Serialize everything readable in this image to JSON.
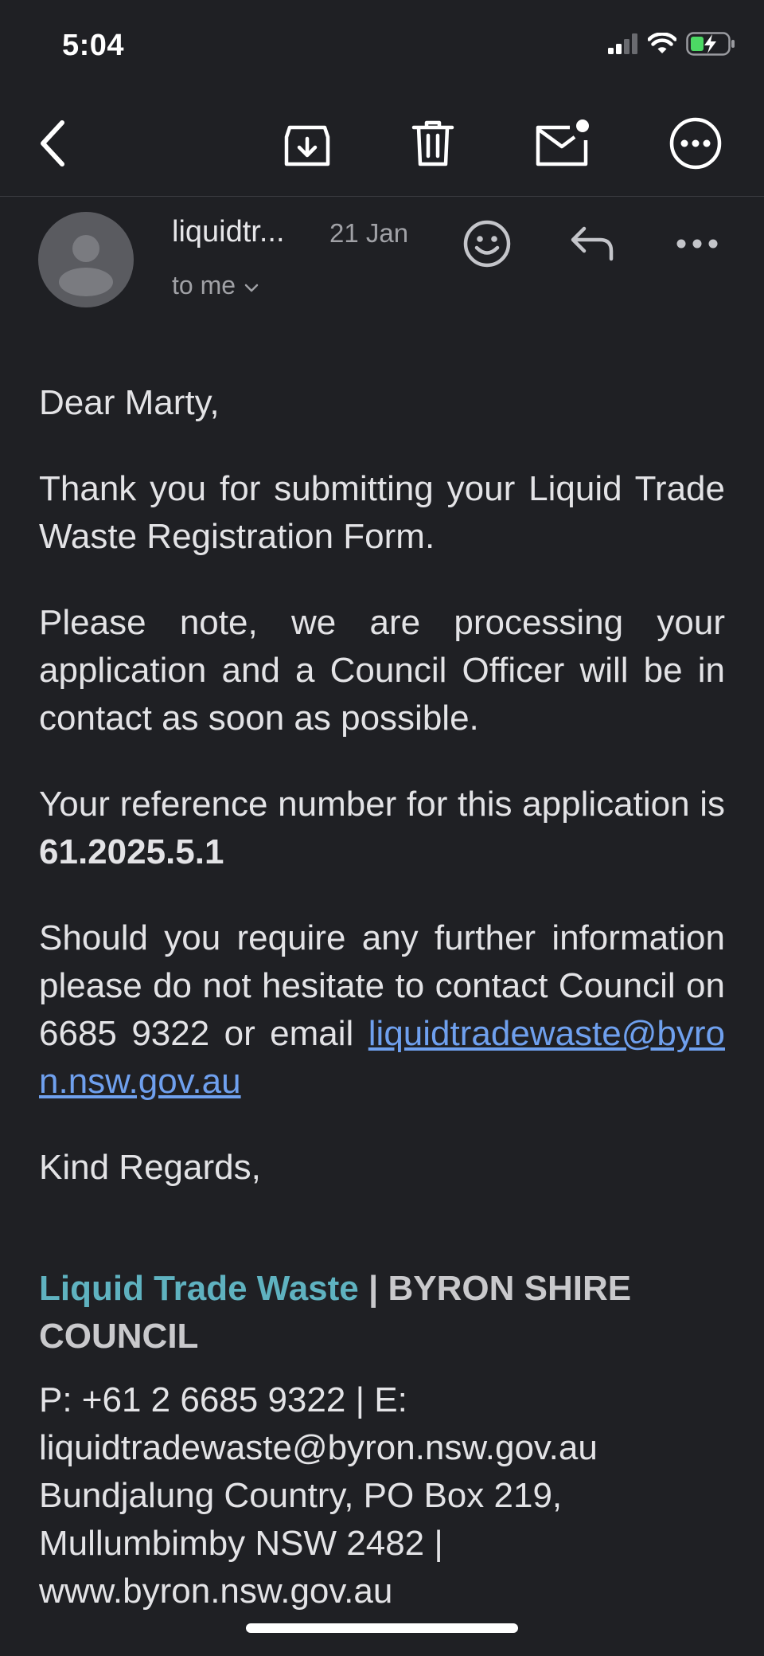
{
  "status_bar": {
    "time": "5:04"
  },
  "toolbar": {
    "icons": [
      "back-arrow-icon",
      "archive-icon",
      "trash-icon",
      "mark-unread-icon",
      "more-circle-icon"
    ]
  },
  "email": {
    "sender": "liquidtr...",
    "date": "21 Jan",
    "recipient": "to me",
    "greeting": "Dear Marty,",
    "para1": "Thank you for submitting your Liquid Trade Waste Registration Form.",
    "para2": "Please note, we are processing your application and a Council Officer will be in contact as soon as possible.",
    "para3_prefix": "Your reference number for this application is ",
    "reference_number": "61.2025.5.1",
    "para4_prefix": "Should you require any further information please do not hesitate to contact Council on 6685 9322 or email ",
    "email_link": "liquidtradewaste@byron.nsw.gov.au",
    "closing": "Kind Regards,"
  },
  "signature": {
    "team": "Liquid Trade Waste",
    "separator": " | ",
    "org": "BYRON SHIRE COUNCIL",
    "line1": "P: +61 2 6685 9322 | E:",
    "line2": "liquidtradewaste@byron.nsw.gov.au",
    "line3": "Bundjalung Country, PO Box 219,",
    "line4": "Mullumbimby NSW 2482 |",
    "line5": "www.byron.nsw.gov.au"
  },
  "colors": {
    "background": "#1f2024",
    "link": "#6fa0ee",
    "signature_accent": "#5fb2c0",
    "battery_charging": "#4cd964"
  }
}
